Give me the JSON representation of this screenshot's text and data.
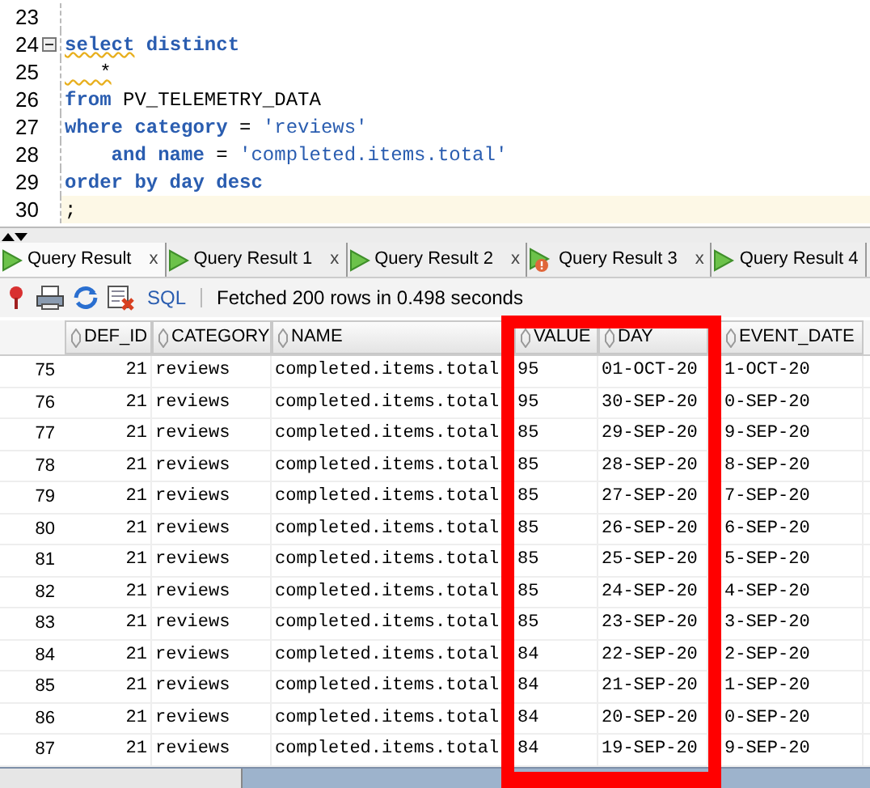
{
  "editor": {
    "lines": [
      {
        "number": "23",
        "current": false,
        "foldable": false
      },
      {
        "number": "24",
        "current": false,
        "foldable": true,
        "segments": [
          {
            "kind": "warned_keyword",
            "text": "select"
          },
          {
            "kind": "keyword",
            "text": " distinct"
          }
        ]
      },
      {
        "number": "25",
        "current": false,
        "foldable": false,
        "segments": [
          {
            "kind": "warned_plain",
            "text": "   *"
          }
        ]
      },
      {
        "number": "26",
        "current": false,
        "foldable": false,
        "segments": [
          {
            "kind": "keyword",
            "text": "from"
          },
          {
            "kind": "plain",
            "text": " PV_TELEMETRY_DATA"
          }
        ]
      },
      {
        "number": "27",
        "current": false,
        "foldable": false,
        "segments": [
          {
            "kind": "keyword",
            "text": "where category"
          },
          {
            "kind": "plain",
            "text": " = "
          },
          {
            "kind": "string",
            "text": "'reviews'"
          }
        ]
      },
      {
        "number": "28",
        "current": false,
        "foldable": false,
        "segments": [
          {
            "kind": "keyword",
            "text": "    and name"
          },
          {
            "kind": "plain",
            "text": " = "
          },
          {
            "kind": "string",
            "text": "'completed.items.total'"
          }
        ]
      },
      {
        "number": "29",
        "current": false,
        "foldable": false,
        "segments": [
          {
            "kind": "keyword",
            "text": "order by day desc"
          }
        ]
      },
      {
        "number": "30",
        "current": true,
        "foldable": false,
        "segments": [
          {
            "kind": "plain",
            "text": ";"
          }
        ]
      }
    ]
  },
  "tabs": [
    {
      "label": "Query Result",
      "kind": "run",
      "selected": true,
      "close": "x"
    },
    {
      "label": "Query Result 1",
      "kind": "run",
      "selected": false,
      "close": "x"
    },
    {
      "label": "Query Result 2",
      "kind": "run",
      "selected": false,
      "close": "x"
    },
    {
      "label": "Query Result 3",
      "kind": "warning",
      "selected": false,
      "close": "x"
    },
    {
      "label": "Query Result 4",
      "kind": "run",
      "selected": false
    }
  ],
  "toolbar": {
    "sql_link": "SQL",
    "status": "Fetched 200 rows in 0.498 seconds"
  },
  "table": {
    "columns": [
      "DEF_ID",
      "CATEGORY",
      "NAME",
      "VALUE",
      "DAY",
      "EVENT_DATE"
    ],
    "rows": [
      {
        "number": "75",
        "cells": [
          "21",
          "reviews",
          "completed.items.total",
          "95",
          "01-OCT-20",
          "1-OCT-20"
        ]
      },
      {
        "number": "76",
        "cells": [
          "21",
          "reviews",
          "completed.items.total",
          "95",
          "30-SEP-20",
          "0-SEP-20"
        ]
      },
      {
        "number": "77",
        "cells": [
          "21",
          "reviews",
          "completed.items.total",
          "85",
          "29-SEP-20",
          "9-SEP-20"
        ]
      },
      {
        "number": "78",
        "cells": [
          "21",
          "reviews",
          "completed.items.total",
          "85",
          "28-SEP-20",
          "8-SEP-20"
        ]
      },
      {
        "number": "79",
        "cells": [
          "21",
          "reviews",
          "completed.items.total",
          "85",
          "27-SEP-20",
          "7-SEP-20"
        ]
      },
      {
        "number": "80",
        "cells": [
          "21",
          "reviews",
          "completed.items.total",
          "85",
          "26-SEP-20",
          "6-SEP-20"
        ]
      },
      {
        "number": "81",
        "cells": [
          "21",
          "reviews",
          "completed.items.total",
          "85",
          "25-SEP-20",
          "5-SEP-20"
        ]
      },
      {
        "number": "82",
        "cells": [
          "21",
          "reviews",
          "completed.items.total",
          "85",
          "24-SEP-20",
          "4-SEP-20"
        ]
      },
      {
        "number": "83",
        "cells": [
          "21",
          "reviews",
          "completed.items.total",
          "85",
          "23-SEP-20",
          "3-SEP-20"
        ]
      },
      {
        "number": "84",
        "cells": [
          "21",
          "reviews",
          "completed.items.total",
          "84",
          "22-SEP-20",
          "2-SEP-20"
        ]
      },
      {
        "number": "85",
        "cells": [
          "21",
          "reviews",
          "completed.items.total",
          "84",
          "21-SEP-20",
          "1-SEP-20"
        ]
      },
      {
        "number": "86",
        "cells": [
          "21",
          "reviews",
          "completed.items.total",
          "84",
          "20-SEP-20",
          "0-SEP-20"
        ]
      },
      {
        "number": "87",
        "cells": [
          "21",
          "reviews",
          "completed.items.total",
          "84",
          "19-SEP-20",
          "9-SEP-20"
        ]
      }
    ]
  }
}
